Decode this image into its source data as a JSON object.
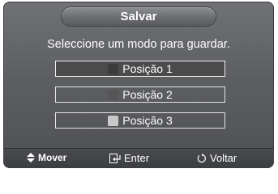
{
  "dialog": {
    "title": "Salvar",
    "prompt": "Seleccione um modo para guardar."
  },
  "options": [
    {
      "label": "Posição 1",
      "swatch_color": "#3c3c3c",
      "selected": true
    },
    {
      "label": "Posição 2",
      "swatch_color": "#565656",
      "selected": false
    },
    {
      "label": "Posição 3",
      "swatch_color": "#c8c8c8",
      "selected": false
    }
  ],
  "footer": {
    "move_label": "Mover",
    "move_icon": "up-down-arrows-icon",
    "enter_label": "Enter",
    "enter_icon": "enter-icon",
    "return_label": "Voltar",
    "return_icon": "return-icon"
  }
}
